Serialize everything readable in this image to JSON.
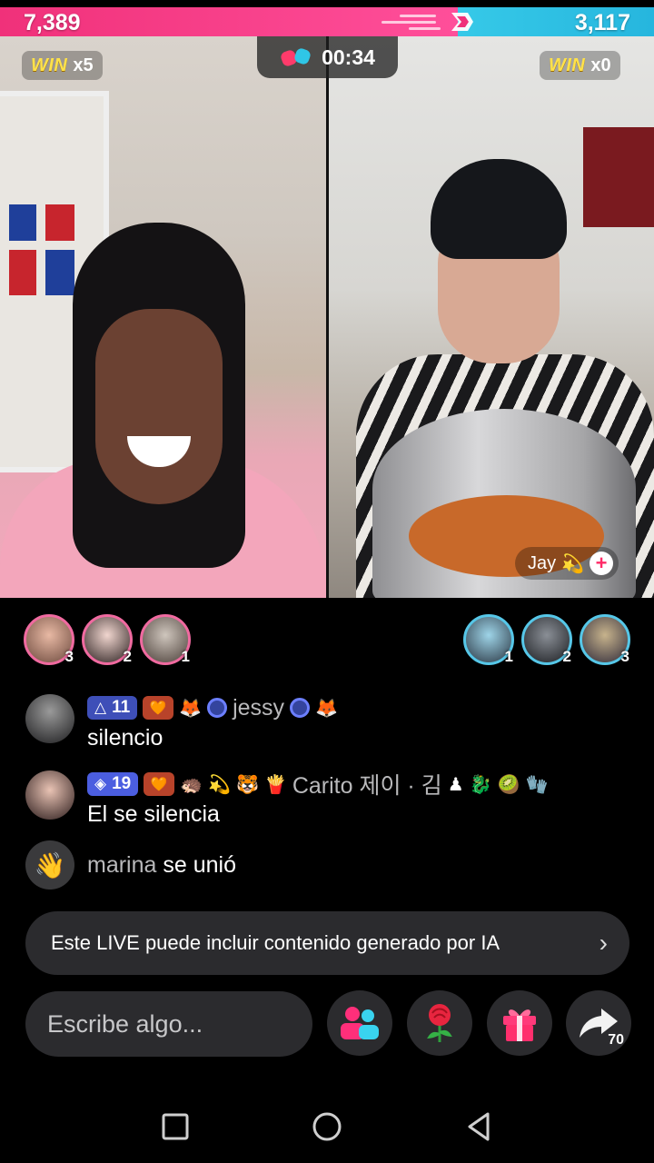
{
  "battle": {
    "left_score": "7,389",
    "right_score": "3,117",
    "left_share": 0.7,
    "timer": "00:34",
    "left_win_label": "WIN",
    "left_win_count": "x5",
    "right_win_label": "WIN",
    "right_win_count": "x0",
    "colors": {
      "left": "#f0317a",
      "right": "#36c9e8"
    }
  },
  "host_tag": {
    "name": "Jay",
    "emoji": "💫",
    "follow_icon": "plus-icon"
  },
  "supporters": {
    "left": [
      {
        "rank": "3"
      },
      {
        "rank": "2"
      },
      {
        "rank": "1"
      }
    ],
    "right": [
      {
        "rank": "1"
      },
      {
        "rank": "2"
      },
      {
        "rank": "3"
      }
    ]
  },
  "chat": [
    {
      "level": "11",
      "badge_emojis": [
        "🧡",
        "🦊"
      ],
      "username": "jessy",
      "trailing_emojis": [
        "🦊"
      ],
      "message": "silencio"
    },
    {
      "level": "19",
      "badge_emojis": [
        "🧡",
        "🦔",
        "💫",
        "🐯",
        "🍟"
      ],
      "username": "Carito 제이 · 김",
      "trailing_emojis": [
        "♟",
        "🐉",
        "🥝",
        "🧤"
      ],
      "message": "El se silencia"
    }
  ],
  "join": {
    "user": "marina",
    "text": "se unió"
  },
  "ai_notice": {
    "text": "Este LIVE puede incluir contenido generado por IA"
  },
  "composer": {
    "placeholder": "Escribe algo..."
  },
  "actions": {
    "share_count": "70"
  }
}
